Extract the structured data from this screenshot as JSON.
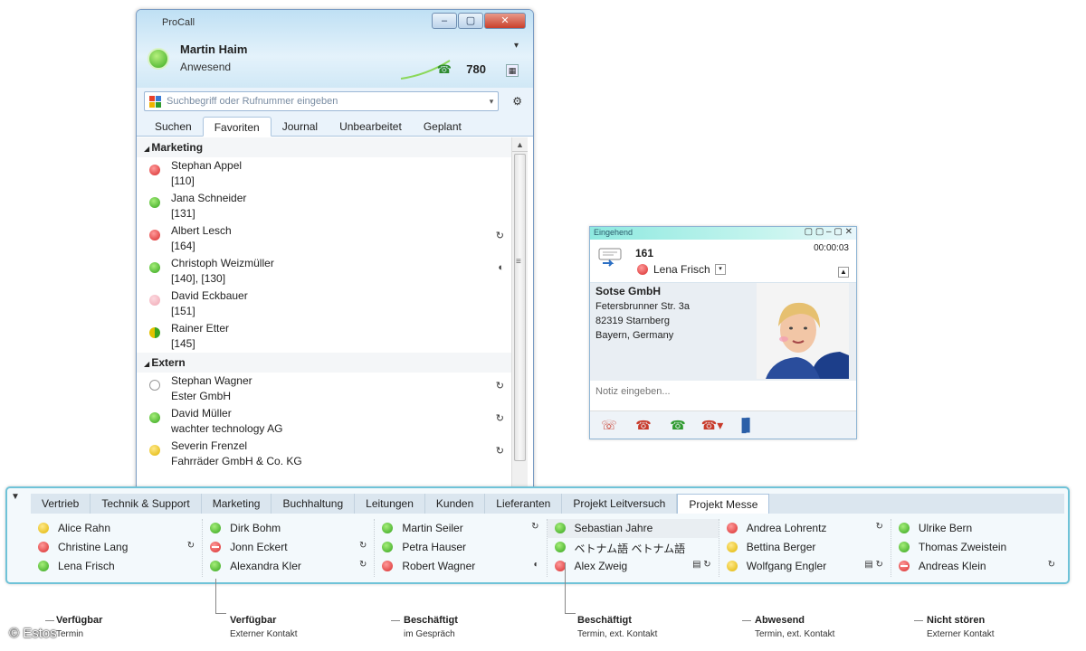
{
  "main": {
    "app_title": "ProCall",
    "user_name": "Martin Haim",
    "user_status": "Anwesend",
    "credits": "780",
    "search_placeholder": "Suchbegriff oder Rufnummer eingeben",
    "tabs": [
      "Suchen",
      "Favoriten",
      "Journal",
      "Unbearbeitet",
      "Geplant"
    ],
    "active_tab": "Favoriten",
    "groups": [
      {
        "name": "Marketing",
        "contacts": [
          {
            "name": "Stephan Appel",
            "sub": "[110]",
            "status": "red",
            "action": ""
          },
          {
            "name": "Jana Schneider",
            "sub": "[131]",
            "status": "green",
            "action": ""
          },
          {
            "name": "Albert Lesch",
            "sub": "[164]",
            "status": "red",
            "action": "↻"
          },
          {
            "name": "Christoph Weizmüller",
            "sub": "[140], [130]",
            "status": "green",
            "action": "◐"
          },
          {
            "name": "David Eckbauer",
            "sub": "[151]",
            "status": "pink",
            "action": ""
          },
          {
            "name": "Rainer Etter",
            "sub": "[145]",
            "status": "greenyellow",
            "action": ""
          }
        ]
      },
      {
        "name": "Extern",
        "contacts": [
          {
            "name": "Stephan Wagner",
            "sub": "Ester GmbH",
            "status": "offline",
            "action": "↻"
          },
          {
            "name": "David Müller",
            "sub": "wachter technology AG",
            "status": "green",
            "action": "↻"
          },
          {
            "name": "Severin Frenzel",
            "sub": "Fahrräder GmbH & Co. KG",
            "status": "yellow",
            "action": "↻"
          }
        ]
      }
    ]
  },
  "call": {
    "title": "Eingehend",
    "title_buttons": "▢ ▢ – ▢ ✕",
    "number": "161",
    "timer": "00:00:03",
    "contact_name": "Lena Frisch",
    "company": "Sotse GmbH",
    "address": [
      "Fetersbrunner Str. 3a",
      "82319 Starnberg",
      "Bayern, Germany"
    ],
    "notes_placeholder": "Notiz eingeben..."
  },
  "bar": {
    "tabs": [
      "Vertrieb",
      "Technik & Support",
      "Marketing",
      "Buchhaltung",
      "Leitungen",
      "Kunden",
      "Lieferanten",
      "Projekt Leitversuch",
      "Projekt Messe"
    ],
    "active_tab": "Projekt Messe",
    "columns": [
      [
        {
          "name": "Alice Rahn",
          "status": "yellow",
          "action": ""
        },
        {
          "name": "Christine Lang",
          "status": "red",
          "action": "↻"
        },
        {
          "name": "Lena Frisch",
          "status": "green",
          "action": ""
        }
      ],
      [
        {
          "name": "Dirk Bohm",
          "status": "green",
          "action": ""
        },
        {
          "name": "Jonn Eckert",
          "status": "dnd",
          "action": "↻"
        },
        {
          "name": "Alexandra Kler",
          "status": "green",
          "action": "↻"
        }
      ],
      [
        {
          "name": "Martin Seiler",
          "status": "green",
          "action": "↻"
        },
        {
          "name": "Petra Hauser",
          "status": "green",
          "action": ""
        },
        {
          "name": "Robert Wagner",
          "status": "red",
          "action": "◐"
        }
      ],
      [
        {
          "name": "Sebastian Jahre",
          "status": "green",
          "action": "",
          "highlight": true
        },
        {
          "name": "ベトナム語 ベトナム語",
          "status": "green",
          "action": ""
        },
        {
          "name": "Alex Zweig",
          "status": "red",
          "action": "▤ ↻"
        }
      ],
      [
        {
          "name": "Andrea Lohrentz",
          "status": "red",
          "action": "↻"
        },
        {
          "name": "Bettina Berger",
          "status": "yellow",
          "action": ""
        },
        {
          "name": "Wolfgang Engler",
          "status": "yellow",
          "action": "▤ ↻"
        }
      ],
      [
        {
          "name": "Ulrike Bern",
          "status": "green",
          "action": ""
        },
        {
          "name": "Thomas Zweistein",
          "status": "green",
          "action": ""
        },
        {
          "name": "Andreas Klein",
          "status": "dnd",
          "action": "↻"
        }
      ]
    ]
  },
  "legend": [
    {
      "title": "Verfügbar",
      "sub": "Termin"
    },
    {
      "title": "Verfügbar",
      "sub": "Externer Kontakt"
    },
    {
      "title": "Beschäftigt",
      "sub": "im Gespräch"
    },
    {
      "title": "Beschäftigt",
      "sub": "Termin, ext. Kontakt"
    },
    {
      "title": "Abwesend",
      "sub": "Termin, ext. Kontakt"
    },
    {
      "title": "Nicht stören",
      "sub": "Externer Kontakt"
    }
  ],
  "copyright": "© Estos",
  "icons": {
    "self_status": "presence-icon",
    "search_logo": "procall-logo-icon",
    "phone_incoming": "incoming-call-icon"
  },
  "colors": {
    "accent": "#6fc3d8",
    "available": "#33a31c",
    "busy": "#d72b2b",
    "away": "#e0b400"
  }
}
